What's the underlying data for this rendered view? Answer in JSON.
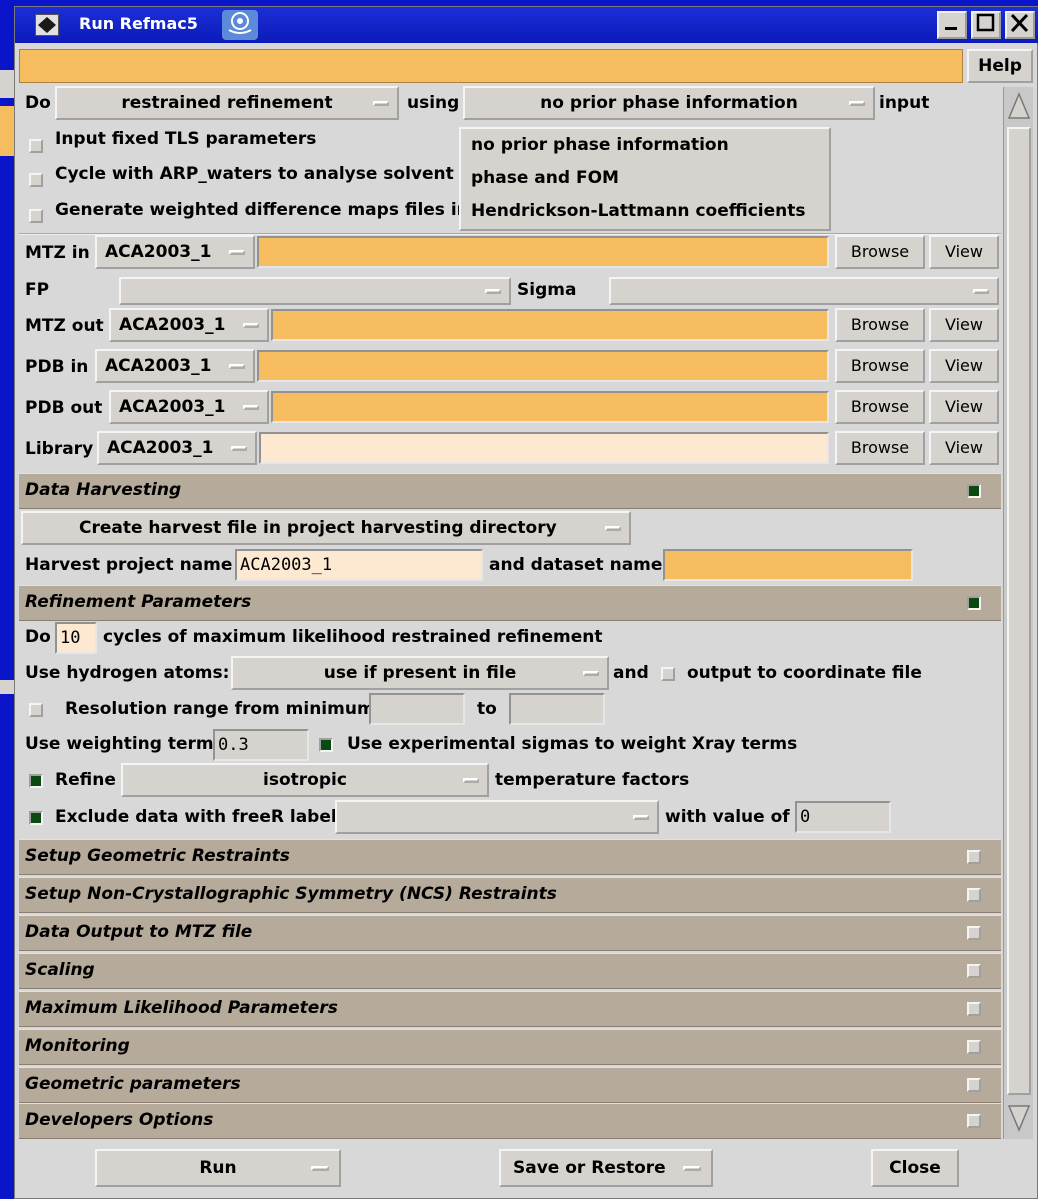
{
  "window": {
    "title": "Run Refmac5"
  },
  "help_label": "Help",
  "header": {
    "do_label": "Do",
    "mode_value": "restrained refinement",
    "using_label": "using",
    "phase_value": "no prior phase information",
    "input_label": "input"
  },
  "phase_menu": {
    "items": [
      "no prior phase information",
      "phase and FOM",
      "Hendrickson-Lattmann coefficients"
    ]
  },
  "options": {
    "tls_label": "Input fixed TLS parameters",
    "arp_label": "Cycle with ARP_waters to analyse solvent",
    "diffmap_label": "Generate weighted difference maps files in"
  },
  "files": {
    "mtz_in_label": "MTZ in",
    "mtz_in_project": "ACA2003_1",
    "fp_label": "FP",
    "sigma_label": "Sigma",
    "mtz_out_label": "MTZ out",
    "mtz_out_project": "ACA2003_1",
    "pdb_in_label": "PDB in",
    "pdb_in_project": "ACA2003_1",
    "pdb_out_label": "PDB out",
    "pdb_out_project": "ACA2003_1",
    "library_label": "Library",
    "library_project": "ACA2003_1",
    "browse_label": "Browse",
    "view_label": "View"
  },
  "harvest": {
    "section_title": "Data Harvesting",
    "mode_value": "Create harvest file in project harvesting directory",
    "project_label": "Harvest project name",
    "project_value": "ACA2003_1",
    "dataset_label": "and dataset name",
    "dataset_value": ""
  },
  "refinement": {
    "section_title": "Refinement Parameters",
    "do_label": "Do",
    "cycles_value": "10",
    "cycles_label": "cycles of maximum likelihood restrained refinement",
    "hydrogen_label": "Use hydrogen atoms:",
    "hydrogen_value": "use if present in file",
    "and_label": "and",
    "output_coord_label": "output to coordinate file",
    "resolution_label": "Resolution range from minimum",
    "to_label": "to",
    "weight_label": "Use weighting term",
    "weight_value": "0.3",
    "sigmas_label": "Use experimental sigmas to weight Xray terms",
    "refine_label": "Refine",
    "refine_value": "isotropic",
    "temp_label": "temperature factors",
    "exclude_label": "Exclude data with freeR label",
    "with_value_label": "with value of",
    "with_value": "0"
  },
  "sections": [
    "Setup Geometric Restraints",
    "Setup Non-Crystallographic Symmetry (NCS) Restraints",
    "Data Output to MTZ file",
    "Scaling",
    "Maximum Likelihood Parameters",
    "Monitoring",
    "Geometric parameters",
    "Developers Options"
  ],
  "footer": {
    "run_label": "Run",
    "save_label": "Save or Restore",
    "close_label": "Close"
  }
}
